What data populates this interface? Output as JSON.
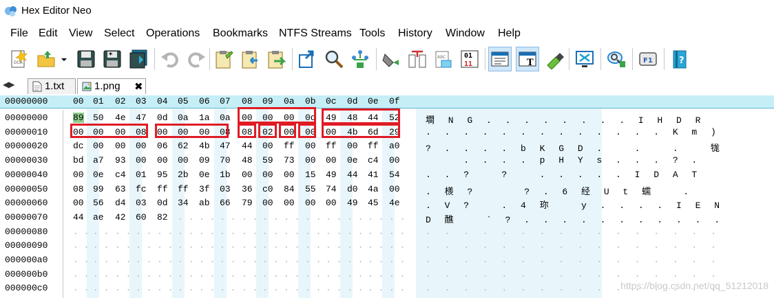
{
  "app": {
    "title": "Hex Editor Neo"
  },
  "menu": [
    "File",
    "Edit",
    "View",
    "Select",
    "Operations",
    "Bookmarks",
    "NTFS Streams",
    "Tools",
    "History",
    "Window",
    "Help"
  ],
  "toolbar": {
    "icons": [
      "new-file-icon",
      "open-file-icon",
      "open-dropdown-icon",
      "save-icon",
      "save-as-icon",
      "save-all-icon",
      "undo-icon",
      "redo-icon",
      "copy-icon",
      "paste-icon",
      "paste-append-icon",
      "goto-icon",
      "find-icon",
      "structure-icon",
      "fill-icon",
      "compare-icon",
      "patterns-icon",
      "encode-icon",
      "hex-view-icon",
      "text-view-icon",
      "highlight-icon",
      "fullscreen-icon",
      "help-balloon-icon",
      "f1-help-icon",
      "book-icon"
    ],
    "encode_glyph_top": "01",
    "encode_glyph_bottom": "11",
    "f1_label": "F1"
  },
  "tabs": [
    {
      "label": "1.txt",
      "active": false
    },
    {
      "label": "1.png",
      "active": true,
      "close": "✖"
    }
  ],
  "tab_nav": "◀▶",
  "editor": {
    "offset_header": "00000000",
    "columns": [
      "00",
      "01",
      "02",
      "03",
      "04",
      "05",
      "06",
      "07",
      "08",
      "09",
      "0a",
      "0b",
      "0c",
      "0d",
      "0e",
      "0f"
    ],
    "offsets": [
      "00000000",
      "00000010",
      "00000020",
      "00000030",
      "00000040",
      "00000050",
      "00000060",
      "00000070",
      "00000080",
      "00000090",
      "000000a0",
      "000000b0",
      "000000c0"
    ],
    "rows": [
      [
        "89",
        "50",
        "4e",
        "47",
        "0d",
        "0a",
        "1a",
        "0a",
        "00",
        "00",
        "00",
        "0d",
        "49",
        "48",
        "44",
        "52"
      ],
      [
        "00",
        "00",
        "00",
        "08",
        "00",
        "00",
        "00",
        "08",
        "08",
        "02",
        "00",
        "00",
        "00",
        "4b",
        "6d",
        "29"
      ],
      [
        "dc",
        "00",
        "00",
        "00",
        "06",
        "62",
        "4b",
        "47",
        "44",
        "00",
        "ff",
        "00",
        "ff",
        "00",
        "ff",
        "a0"
      ],
      [
        "bd",
        "a7",
        "93",
        "00",
        "00",
        "00",
        "09",
        "70",
        "48",
        "59",
        "73",
        "00",
        "00",
        "0e",
        "c4",
        "00"
      ],
      [
        "00",
        "0e",
        "c4",
        "01",
        "95",
        "2b",
        "0e",
        "1b",
        "00",
        "00",
        "00",
        "15",
        "49",
        "44",
        "41",
        "54"
      ],
      [
        "08",
        "99",
        "63",
        "fc",
        "ff",
        "ff",
        "3f",
        "03",
        "36",
        "c0",
        "84",
        "55",
        "74",
        "d0",
        "4a",
        "00"
      ],
      [
        "00",
        "56",
        "d4",
        "03",
        "0d",
        "34",
        "ab",
        "66",
        "79",
        "00",
        "00",
        "00",
        "00",
        "49",
        "45",
        "4e"
      ],
      [
        "44",
        "ae",
        "42",
        "60",
        "82"
      ]
    ],
    "text_rows": [
      "墹 N G . . . . . . . . I H D R",
      ". . . . . . . . . . . . . K m )",
      "? . . . . b K G D .   .   .   牻",
      "    . . . . p H Y s . . . ? .",
      ". . ?   ?   . . . . . I D A T",
      ". 檨 ?     ? . 6 经 U t 蠕   .",
      ". V ?   . 4 珎   y . . . . I E N",
      "D 醮   ` ? . . . . . . . . . . .",
      ". . . . . . . . . . . . . . . .",
      ". . . . . . . . . . . . . . . .",
      ". . . . . . . . . . . . . . . .",
      ". . . . . . . . . . . . . . . .",
      ". . . . . . . . . . . . . . . ."
    ],
    "empty_cell": ". .",
    "selected_byte": "89"
  },
  "watermark": "https://blog.csdn.net/qq_51212018",
  "colors": {
    "header_band": "#c6eef6",
    "column_band": "#e8f6fb",
    "selection": "#8fcf8f",
    "highlight_box": "#e01b24"
  }
}
